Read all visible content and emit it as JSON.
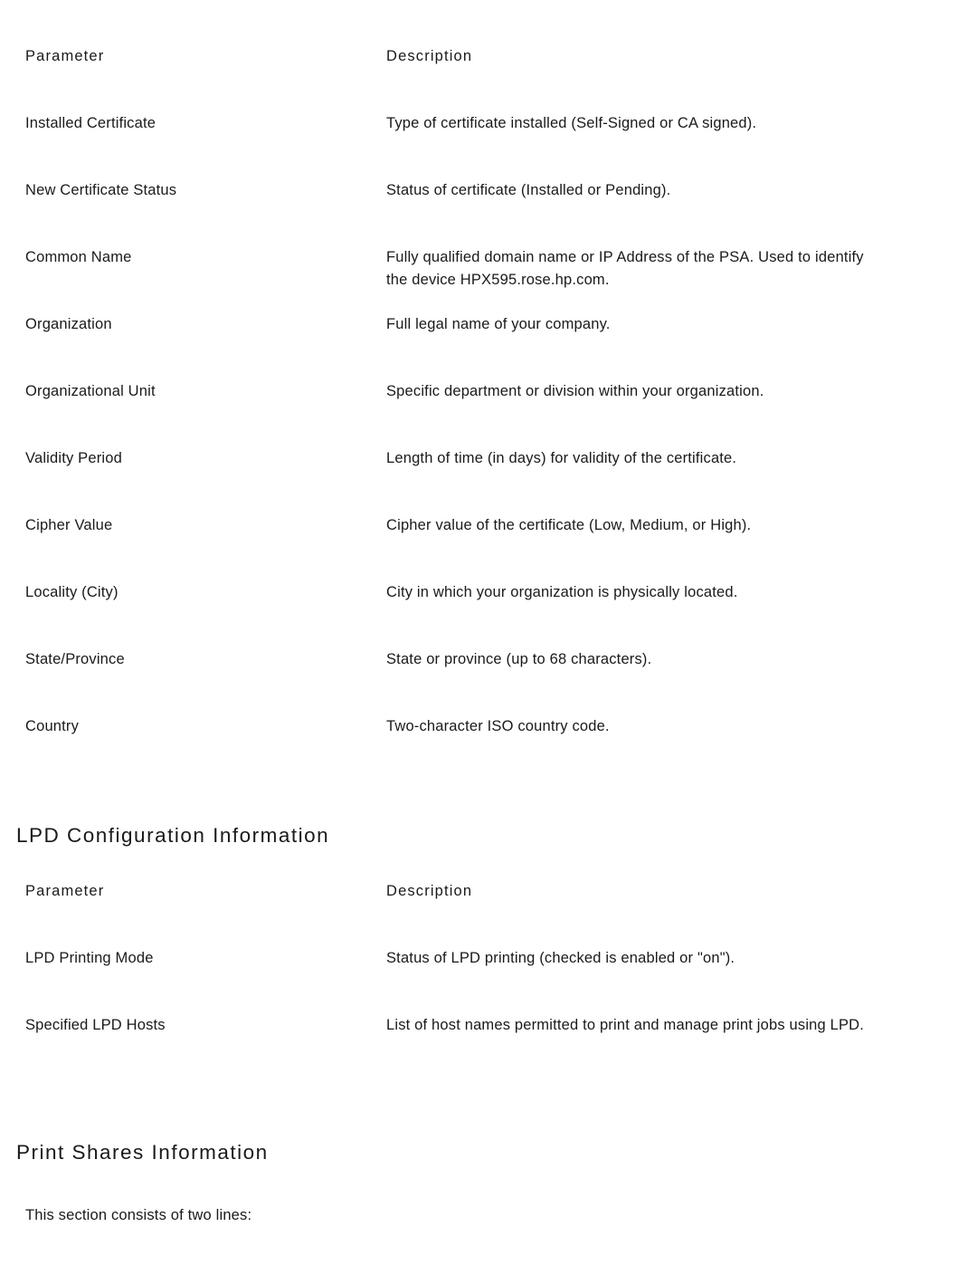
{
  "document": {
    "background_color": "#ffffff",
    "text_color": "#1a1a1a"
  },
  "certificate_table": {
    "columns": {
      "parameter": "Parameter",
      "description": "Description"
    },
    "rows": [
      {
        "parameter": "Installed Certificate",
        "description": "Type of certificate installed (Self-Signed or CA signed)."
      },
      {
        "parameter": "New Certificate Status",
        "description": "Status of certificate (Installed or Pending)."
      },
      {
        "parameter": "Common Name",
        "description": "Fully qualified domain name or IP Address of the PSA. Used to identify\nthe device HPX595.rose.hp.com."
      },
      {
        "parameter": "Organization",
        "description": "Full legal name of your company."
      },
      {
        "parameter": "Organizational Unit",
        "description": "Specific department or division within your organization."
      },
      {
        "parameter": "Validity Period",
        "description": "Length of time (in days) for validity of the certificate."
      },
      {
        "parameter": "Cipher Value",
        "description": "Cipher value of the certificate (Low, Medium, or High)."
      },
      {
        "parameter": "Locality (City)",
        "description": "City in which your organization is physically located."
      },
      {
        "parameter": "State/Province",
        "description": "State or province (up to 68 characters)."
      },
      {
        "parameter": "Country",
        "description": "Two-character ISO country code."
      }
    ]
  },
  "lpd_section": {
    "heading": "LPD Configuration Information",
    "table": {
      "columns": {
        "parameter": "Parameter",
        "description": "Description"
      },
      "rows": [
        {
          "parameter": "LPD Printing Mode",
          "description": "Status of LPD printing (checked is enabled or \"on\")."
        },
        {
          "parameter": "Specified LPD Hosts",
          "description": "List of host names permitted to print and manage print jobs using LPD."
        }
      ]
    }
  },
  "print_shares_section": {
    "heading": "Print Shares Information",
    "intro": "This section consists of two lines:"
  }
}
